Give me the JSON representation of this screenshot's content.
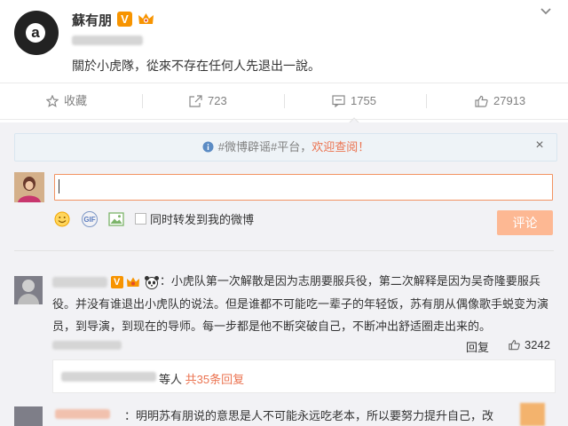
{
  "post": {
    "author": "蘇有朋",
    "verified_badge": "V",
    "text": "關於小虎隊，從來不存在任何人先退出一說。",
    "avatar_letter": "a"
  },
  "actions": {
    "favorite_label": "收藏",
    "repost_count": "723",
    "comment_count": "1755",
    "like_count": "27913"
  },
  "notice": {
    "prefix": "#微博辟谣#平台，",
    "link": "欢迎查阅！",
    "close": "×"
  },
  "composer": {
    "repost_checkbox_label": "同时转发到我的微博",
    "send_label": "评论",
    "gif_label": "GIF"
  },
  "comments": [
    {
      "verified_badge": "V",
      "text_lines": [
        "：小虎队第一次解散是因为志朋要服兵役，第二次解释是因为吴奇隆要服兵",
        "役。并没有谁退出小虎队的说法。但是谁都不可能吃一辈子的年轻饭，苏有朋从偶像歌手蜕变为演",
        "员，到导演，到现在的导师。每一步都是他不断突破自己，不断冲出舒适圈走出来的。"
      ],
      "reply_label": "回复",
      "likes": "3242",
      "sub_replies_prefix": "等人",
      "sub_replies_link": "共35条回复"
    },
    {
      "text": "：明明苏有朋说的意思是人不可能永远吃老本，所以要努力提升自己，改"
    }
  ],
  "colors": {
    "accent": "#eb7350",
    "vip_orange": "#f79400",
    "panel_bg": "#f2f2f5"
  }
}
